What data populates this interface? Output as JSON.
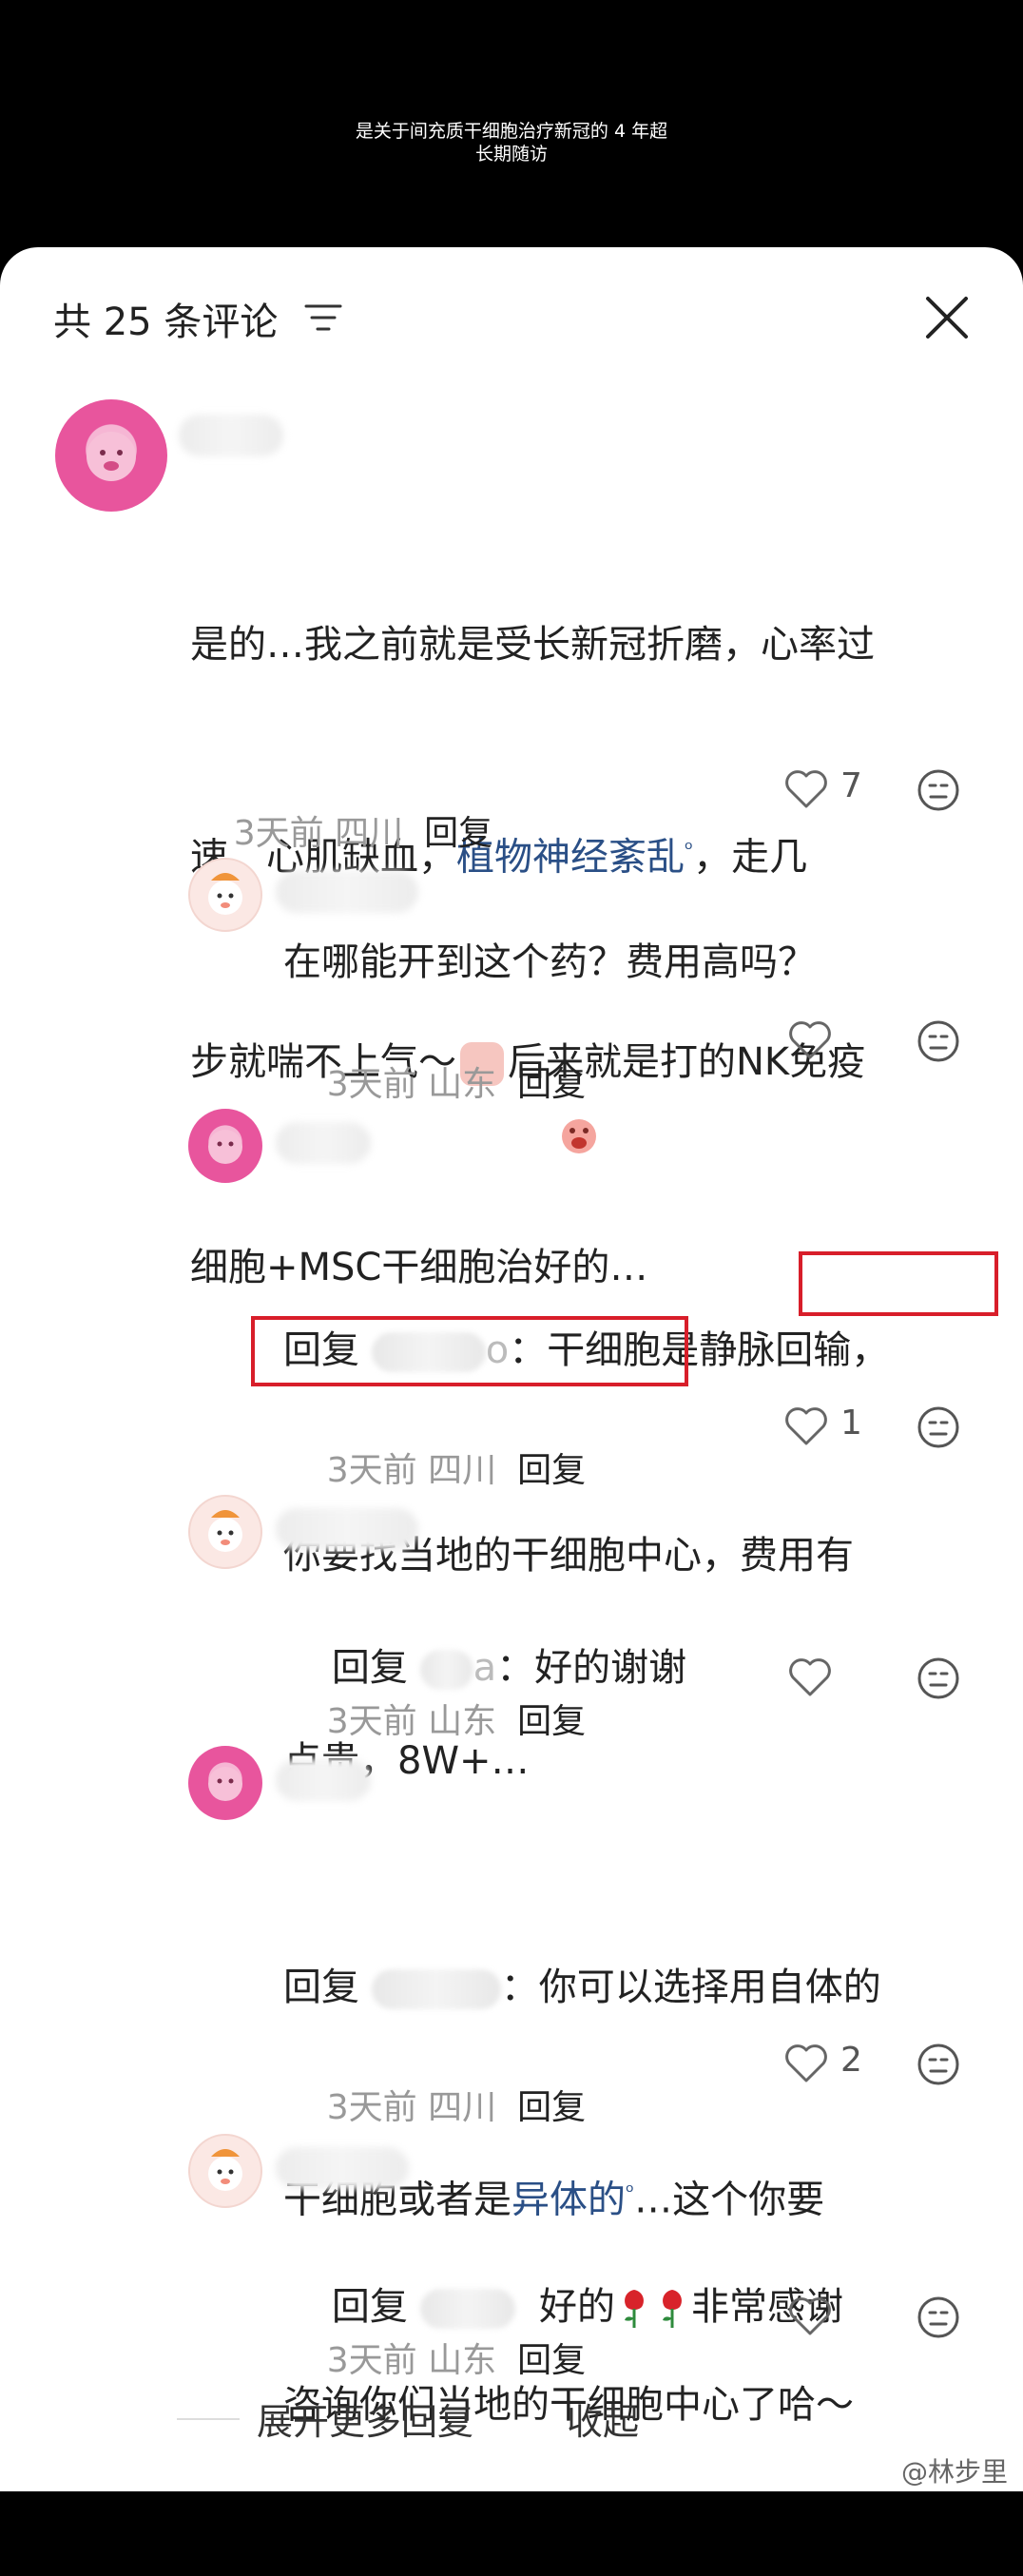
{
  "video_caption": {
    "line1": "是关于间充质干细胞治疗新冠的 4 年超",
    "line2": "长期随访"
  },
  "header": {
    "title": "共 25 条评论",
    "icons": [
      "filter-icon",
      "close-icon"
    ]
  },
  "comments": [
    {
      "text": {
        "line1": "是的…我之前就是受长新冠折磨，心率过",
        "line2_a": "速，心肌缺血，",
        "line2_link": "植物神经紊乱",
        "line2_b": "，走几",
        "line3_a": "步就喘不上气～",
        "line3_b": "后来就是打的NK免疫",
        "line4": "细胞+MSC干细胞治好的…"
      },
      "time": "3天前",
      "location": "四川",
      "reply_label": "回复",
      "likes": "7"
    },
    {
      "text": "在哪能开到这个药？费用高吗？",
      "time": "3天前",
      "location": "山东",
      "reply_label": "回复",
      "likes": ""
    },
    {
      "text": {
        "prefix": "回复",
        "blur_suffix": "o",
        "line1_b": "：干细胞是静脉回输，",
        "line2": "你要找当地的干细胞中心，费用有",
        "line3": "点贵，8W+…"
      },
      "time": "3天前",
      "location": "四川",
      "reply_label": "回复",
      "likes": "1"
    },
    {
      "text": {
        "prefix": "回复",
        "blur_suffix": "a",
        "rest": "：好的谢谢"
      },
      "time": "3天前",
      "location": "山东",
      "reply_label": "回复",
      "likes": ""
    },
    {
      "text": {
        "prefix": "回复",
        "line1_b": "：你可以选择用自体的",
        "line2_a": "干细胞或者是",
        "line2_link": "异体的",
        "line2_b": "…这个你要",
        "line3": "咨询你们当地的干细胞中心了哈～"
      },
      "time": "3天前",
      "location": "四川",
      "reply_label": "回复",
      "likes": "2"
    },
    {
      "text": {
        "prefix": "回复",
        "a": "好的",
        "b": "非常感谢"
      },
      "time": "3天前",
      "location": "山东",
      "reply_label": "回复",
      "likes": ""
    }
  ],
  "footer": {
    "expand_label": "展开更多回复",
    "collapse_label": "收起"
  },
  "watermark": "@林步里",
  "colors": {
    "link": "#2a4f86",
    "highlight_box": "#d81e2a",
    "meta_gray": "#999999"
  }
}
